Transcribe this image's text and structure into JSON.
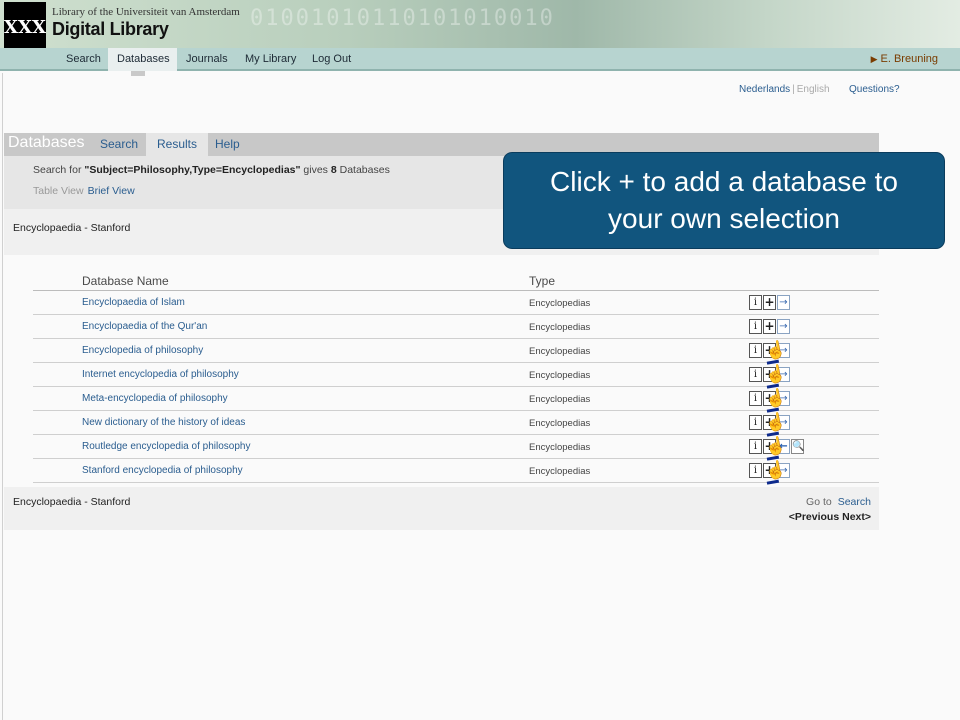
{
  "header": {
    "logo_text": "XXX",
    "university": "Library of the Universiteit van Amsterdam",
    "title": "Digital Library",
    "decoration_digits": "01001010110101010010"
  },
  "nav": {
    "items": [
      {
        "label": "Search",
        "active": false
      },
      {
        "label": "Databases",
        "active": true
      },
      {
        "label": "Journals",
        "active": false
      },
      {
        "label": "My Library",
        "active": false
      },
      {
        "label": "Log Out",
        "active": false
      }
    ],
    "user": "E. Breuning"
  },
  "lang": {
    "nl": "Nederlands",
    "sep": "|",
    "en": "English",
    "questions": "Questions?"
  },
  "tabs": {
    "title": "Databases",
    "items": [
      {
        "label": "Search",
        "active": false
      },
      {
        "label": "Results",
        "active": true
      },
      {
        "label": "Help",
        "active": false
      }
    ]
  },
  "search": {
    "prefix": "Search for ",
    "query": "\"Subject=Philosophy,Type=Encyclopedias\"",
    "gives": " gives ",
    "count": "8",
    "suffix": " Databases",
    "table_view": "Table View",
    "brief_view": "Brief View"
  },
  "strip_label": "Encyclopaedia - Stanford",
  "table": {
    "col_name": "Database Name",
    "col_type": "Type",
    "rows": [
      {
        "name": "Encyclopaedia of Islam",
        "type": "Encyclopedias"
      },
      {
        "name": "Encyclopaedia of the Qur'an",
        "type": "Encyclopedias"
      },
      {
        "name": "Encyclopedia of philosophy",
        "type": "Encyclopedias"
      },
      {
        "name": "Internet encyclopedia of philosophy",
        "type": "Encyclopedias"
      },
      {
        "name": "Meta-encyclopedia of philosophy",
        "type": "Encyclopedias"
      },
      {
        "name": "New dictionary of the history of ideas",
        "type": "Encyclopedias"
      },
      {
        "name": "Routledge encyclopedia of philosophy",
        "type": "Encyclopedias"
      },
      {
        "name": "Stanford encyclopedia of philosophy",
        "type": "Encyclopedias"
      }
    ],
    "icons": {
      "info": "i",
      "add": "+",
      "go": "→",
      "back": "←",
      "search": "🔍",
      "hand": "☝"
    }
  },
  "footer": {
    "goto": "Go to",
    "search": "Search",
    "prev": "<Previous",
    "next": "Next>"
  },
  "callout": {
    "line1": "Click + to add a database to",
    "line2": "your own selection"
  },
  "colors": {
    "nav_bg": "#b7d4d0",
    "callout_bg": "#11557e",
    "link": "#2a5d8f"
  }
}
